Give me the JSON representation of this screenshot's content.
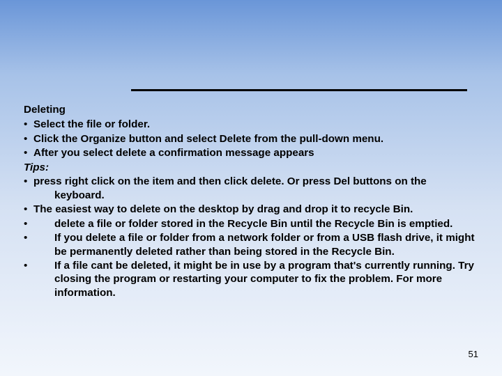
{
  "heading": "Deleting",
  "steps": [
    "Select the file or folder.",
    "Click the Organize button and select Delete from the pull-down menu.",
    "After you select delete a confirmation message appears"
  ],
  "tips_label": "Tips:",
  "tips": [
    "press right click on the item and then click delete. Or press Del buttons on the keyboard.",
    "The easiest way to delete on the desktop by drag and drop it to recycle Bin.",
    "delete a file or folder stored in the Recycle Bin until the Recycle Bin is emptied.",
    "If you delete a file or folder from a network folder or from a USB flash drive, it might be permanently deleted rather than being stored in the Recycle Bin.",
    "If a file cant be deleted, it might be in use by a program that's currently running. Try closing the program or restarting your computer to fix the problem. For more information."
  ],
  "bullet": "•",
  "page_number": "51"
}
